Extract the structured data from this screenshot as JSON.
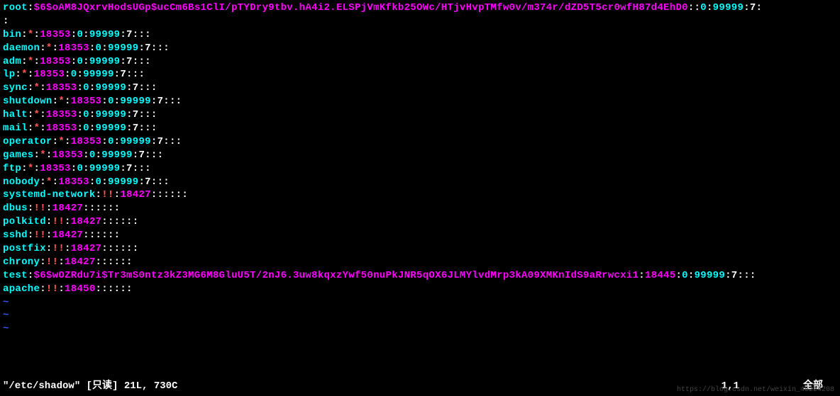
{
  "lines": [
    {
      "type": "entry",
      "user": "root",
      "hashPre": "$6$oAM8JQxrvHodsUGp$ucCm6Bs1ClI/pTYDry9tbv.hA4i2.ELSPjVmKfkb25OWc/HTjvHvpTMfw0v/m374r/dZD5T5cr0wfH87d4EhD0",
      "star": false,
      "bang": false,
      "num1": "",
      "num0": "0",
      "num9": "99999",
      "tail": ":7:::",
      "cont": true
    },
    {
      "type": "cont"
    },
    {
      "type": "entry",
      "user": "bin",
      "hashPre": "",
      "star": true,
      "bang": false,
      "num1": "18353",
      "num0": "0",
      "num9": "99999",
      "tail": ":7:::"
    },
    {
      "type": "entry",
      "user": "daemon",
      "hashPre": "",
      "star": true,
      "bang": false,
      "num1": "18353",
      "num0": "0",
      "num9": "99999",
      "tail": ":7:::"
    },
    {
      "type": "entry",
      "user": "adm",
      "hashPre": "",
      "star": true,
      "bang": false,
      "num1": "18353",
      "num0": "0",
      "num9": "99999",
      "tail": ":7:::"
    },
    {
      "type": "entry",
      "user": "lp",
      "hashPre": "",
      "star": true,
      "bang": false,
      "num1": "18353",
      "num0": "0",
      "num9": "99999",
      "tail": ":7:::"
    },
    {
      "type": "entry",
      "user": "sync",
      "hashPre": "",
      "star": true,
      "bang": false,
      "num1": "18353",
      "num0": "0",
      "num9": "99999",
      "tail": ":7:::"
    },
    {
      "type": "entry",
      "user": "shutdown",
      "hashPre": "",
      "star": true,
      "bang": false,
      "num1": "18353",
      "num0": "0",
      "num9": "99999",
      "tail": ":7:::"
    },
    {
      "type": "entry",
      "user": "halt",
      "hashPre": "",
      "star": true,
      "bang": false,
      "num1": "18353",
      "num0": "0",
      "num9": "99999",
      "tail": ":7:::"
    },
    {
      "type": "entry",
      "user": "mail",
      "hashPre": "",
      "star": true,
      "bang": false,
      "num1": "18353",
      "num0": "0",
      "num9": "99999",
      "tail": ":7:::"
    },
    {
      "type": "entry",
      "user": "operator",
      "hashPre": "",
      "star": true,
      "bang": false,
      "num1": "18353",
      "num0": "0",
      "num9": "99999",
      "tail": ":7:::"
    },
    {
      "type": "entry",
      "user": "games",
      "hashPre": "",
      "star": true,
      "bang": false,
      "num1": "18353",
      "num0": "0",
      "num9": "99999",
      "tail": ":7:::"
    },
    {
      "type": "entry",
      "user": "ftp",
      "hashPre": "",
      "star": true,
      "bang": false,
      "num1": "18353",
      "num0": "0",
      "num9": "99999",
      "tail": ":7:::"
    },
    {
      "type": "entry",
      "user": "nobody",
      "hashPre": "",
      "star": true,
      "bang": false,
      "num1": "18353",
      "num0": "0",
      "num9": "99999",
      "tail": ":7:::"
    },
    {
      "type": "entry",
      "user": "systemd-network",
      "hashPre": "",
      "star": false,
      "bang": true,
      "num1": "18427",
      "num0": "",
      "num9": "",
      "tail": "::::::"
    },
    {
      "type": "entry",
      "user": "dbus",
      "hashPre": "",
      "star": false,
      "bang": true,
      "num1": "18427",
      "num0": "",
      "num9": "",
      "tail": "::::::"
    },
    {
      "type": "entry",
      "user": "polkitd",
      "hashPre": "",
      "star": false,
      "bang": true,
      "num1": "18427",
      "num0": "",
      "num9": "",
      "tail": "::::::"
    },
    {
      "type": "entry",
      "user": "sshd",
      "hashPre": "",
      "star": false,
      "bang": true,
      "num1": "18427",
      "num0": "",
      "num9": "",
      "tail": "::::::"
    },
    {
      "type": "entry",
      "user": "postfix",
      "hashPre": "",
      "star": false,
      "bang": true,
      "num1": "18427",
      "num0": "",
      "num9": "",
      "tail": "::::::"
    },
    {
      "type": "entry",
      "user": "chrony",
      "hashPre": "",
      "star": false,
      "bang": true,
      "num1": "18427",
      "num0": "",
      "num9": "",
      "tail": "::::::"
    },
    {
      "type": "entry",
      "user": "test",
      "hashPre": "$6$wOZRdu7i$Tr3mS0ntz3kZ3MG6M8GluU5T/2nJ6.3uw8kqxzYwf50nuPkJNR5qOX6JLMYlvdMrp3kA09XMKnIdS9aRrwcxi1",
      "star": false,
      "bang": false,
      "num1": "18445",
      "num0": "0",
      "num9": "99999",
      "tail": ":7:::"
    },
    {
      "type": "entry",
      "user": "apache",
      "hashPre": "",
      "star": false,
      "bang": true,
      "num1": "18450",
      "num0": "",
      "num9": "",
      "tail": "::::::"
    }
  ],
  "tildes": [
    "~",
    "~",
    "~"
  ],
  "status": {
    "left": "\"/etc/shadow\" [只读] 21L, 730C",
    "pos": "1,1",
    "right": "全部"
  },
  "watermark": "https://blog.csdn.net/weixin_45254208"
}
